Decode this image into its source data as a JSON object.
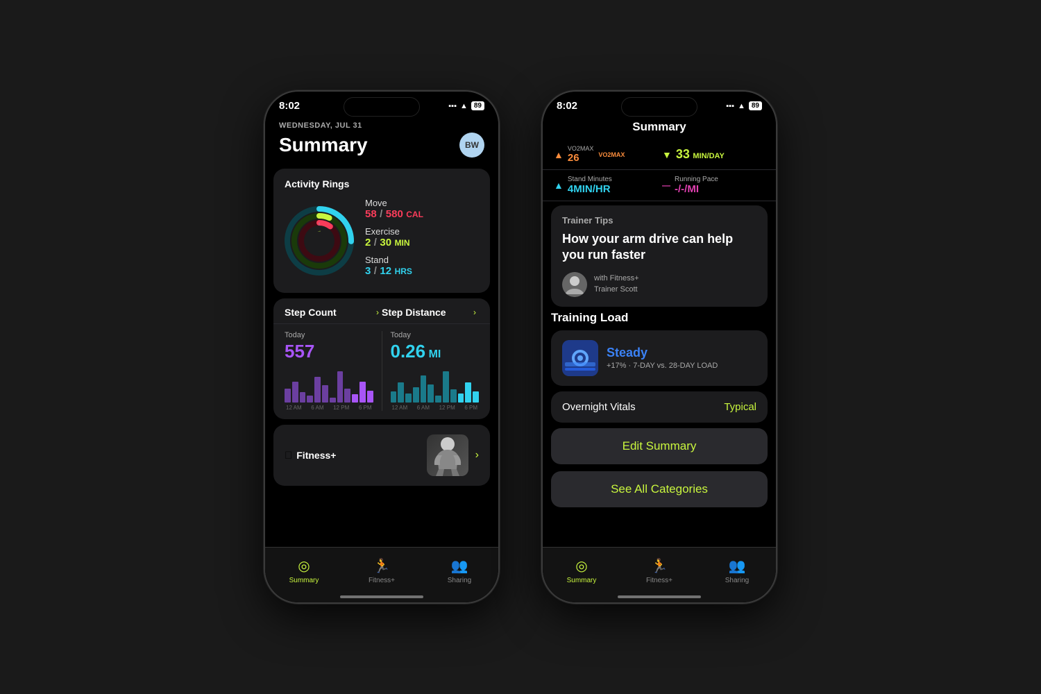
{
  "background": "#1a1a1a",
  "phone1": {
    "status": {
      "time": "8:02",
      "battery": "89",
      "wifi": true
    },
    "header": {
      "date": "WEDNESDAY, JUL 31",
      "title": "Summary",
      "avatar_initials": "BW"
    },
    "activity_rings": {
      "title": "Activity Rings",
      "move": {
        "label": "Move",
        "current": "58",
        "goal": "580",
        "unit": "CAL",
        "color": "#fa3c5a"
      },
      "exercise": {
        "label": "Exercise",
        "current": "2",
        "goal": "30",
        "unit": "MIN",
        "color": "#c8f53e"
      },
      "stand": {
        "label": "Stand",
        "current": "3",
        "goal": "12",
        "unit": "HRS",
        "color": "#31d2ee"
      }
    },
    "step_count": {
      "label": "Step Count",
      "today_label": "Today",
      "value": "557",
      "chart_bars_purple": [
        8,
        12,
        6,
        4,
        15,
        10,
        3,
        18,
        8,
        5,
        12,
        7
      ],
      "chart_labels": [
        "12 AM",
        "6 AM",
        "12 PM",
        "6 PM"
      ]
    },
    "step_distance": {
      "label": "Step Distance",
      "today_label": "Today",
      "value": "0.26",
      "unit": "MI",
      "chart_bars_blue": [
        5,
        9,
        4,
        7,
        12,
        8,
        3,
        14,
        6,
        4,
        9,
        5
      ],
      "chart_labels": [
        "12 AM",
        "6 AM",
        "12 PM",
        "6 PM"
      ]
    },
    "fitness_plus": {
      "label": "Fitness+",
      "chevron": "›"
    },
    "tab_bar": {
      "items": [
        {
          "id": "summary",
          "label": "Summary",
          "active": true
        },
        {
          "id": "fitness",
          "label": "Fitness+",
          "active": false
        },
        {
          "id": "sharing",
          "label": "Sharing",
          "active": false
        }
      ]
    }
  },
  "phone2": {
    "status": {
      "time": "8:02",
      "battery": "89"
    },
    "nav_title": "Summary",
    "metrics": [
      {
        "id": "vo2max",
        "label": "VO2MAX",
        "value": "26",
        "unit": "",
        "color": "#fa8c3c",
        "icon": "▲"
      },
      {
        "id": "exercise_time",
        "label": "MIN/DAY",
        "value": "33",
        "unit": "MIN/DAY",
        "color": "#c8f53e",
        "icon": "▼"
      },
      {
        "id": "stand_minutes",
        "label": "Stand Minutes",
        "value": "4MIN/HR",
        "color": "#31d2ee",
        "icon": "▲"
      },
      {
        "id": "running_pace",
        "label": "Running Pace",
        "value": "-/-/MI",
        "color": "#e040b0",
        "icon": "—"
      }
    ],
    "trainer_tips": {
      "section_label": "Trainer Tips",
      "tip_text": "How your arm drive can help you run faster",
      "trainer_with": "with Fitness+",
      "trainer_name": "Trainer Scott"
    },
    "training_load": {
      "section_label": "Training Load",
      "status": "Steady",
      "detail": "+17% · 7-DAY vs. 28-DAY LOAD",
      "color": "#3b82f6"
    },
    "overnight_vitals": {
      "label": "Overnight Vitals",
      "status": "Typical",
      "status_color": "#c8f53e"
    },
    "buttons": {
      "edit_summary": "Edit Summary",
      "see_all": "See All Categories"
    },
    "tab_bar": {
      "items": [
        {
          "id": "summary",
          "label": "Summary",
          "active": true
        },
        {
          "id": "fitness",
          "label": "Fitness+",
          "active": false
        },
        {
          "id": "sharing",
          "label": "Sharing",
          "active": false
        }
      ]
    }
  }
}
